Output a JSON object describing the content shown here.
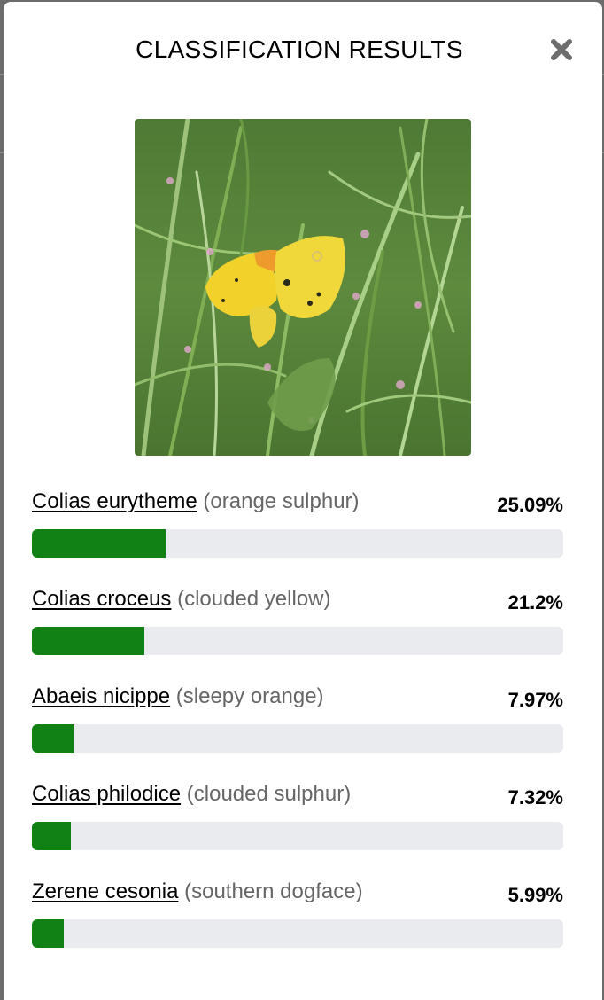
{
  "modal": {
    "title": "CLASSIFICATION RESULTS",
    "close_icon": "close-icon"
  },
  "photo": {
    "subject": "yellow butterfly"
  },
  "colors": {
    "bar_fill": "#118015",
    "bar_track": "#e9ebee",
    "common_name": "#666666"
  },
  "results": [
    {
      "scientific": "Colias eurytheme",
      "common": "(orange sulphur)",
      "percent_label": "25.09%",
      "percent": 25.09
    },
    {
      "scientific": "Colias croceus",
      "common": "(clouded yellow)",
      "percent_label": "21.2%",
      "percent": 21.2
    },
    {
      "scientific": "Abaeis nicippe",
      "common": "(sleepy orange)",
      "percent_label": "7.97%",
      "percent": 7.97
    },
    {
      "scientific": "Colias philodice",
      "common": "(clouded sulphur)",
      "percent_label": "7.32%",
      "percent": 7.32
    },
    {
      "scientific": "Zerene cesonia",
      "common": "(southern dogface)",
      "percent_label": "5.99%",
      "percent": 5.99
    }
  ]
}
